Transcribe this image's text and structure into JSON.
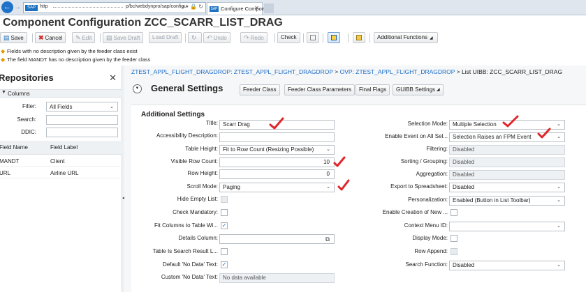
{
  "browser": {
    "protocol": "http",
    "url_visible": "p/bc/webdynpro/sap/configu",
    "address_tools": "⌕ ▾ 🔒 ↻",
    "tab_title": "Configure Component",
    "favicon_text": "SAP"
  },
  "page": {
    "title": "Component Configuration ZCC_SCARR_LIST_DRAG"
  },
  "toolbar": {
    "save": "Save",
    "cancel": "Cancel",
    "edit": "Edit",
    "save_draft": "Save Draft",
    "load_draft": "Load Draft",
    "undo": "Undo",
    "redo": "Redo",
    "check": "Check",
    "additional_functions": "Additional Functions"
  },
  "messages": [
    "Fields with no description given by the feeder class exist",
    "The field MANDT has no description given by the feeder class"
  ],
  "repositories": {
    "title": "Repositories",
    "columns_label": "Columns",
    "filter_label": "Filter:",
    "filter_value": "All Fields",
    "search_label": "Search:",
    "ddic_label": "DDIC:",
    "table_headers": [
      "Field Name",
      "Field Label"
    ],
    "rows": [
      {
        "field_name": "MANDT",
        "field_label": "Client"
      },
      {
        "field_name": "URL",
        "field_label": "Airline URL"
      }
    ]
  },
  "breadcrumb": {
    "link1": "ZTEST_APPL_FLIGHT_DRAGDROP: ZTEST_APPL_FLIGHT_DRAGDROP",
    "sep": " > ",
    "link2": "OVP: ZTEST_APPL_FLIGHT_DRAGDROP",
    "current": "List UIBB: ZCC_SCARR_LIST_DRAG"
  },
  "general_settings": {
    "title": "General Settings",
    "buttons": [
      "Feeder Class",
      "Feeder Class Parameters",
      "Final Flags",
      "GUIBB Settings"
    ]
  },
  "additional_settings": {
    "title": "Additional Settings",
    "left": {
      "title_label": "Title:",
      "title_value": "Scarr Drag",
      "accessibility_label": "Accessibility Description:",
      "table_height_label": "Table Height:",
      "table_height_value": "Fit to Row Count (Resizing Possible)",
      "visible_rows_label": "Visible Row Count:",
      "visible_rows_value": "10",
      "row_height_label": "Row Height:",
      "row_height_value": "0",
      "scroll_mode_label": "Scroll Mode:",
      "scroll_mode_value": "Paging",
      "hide_empty_label": "Hide Empty List:",
      "check_mandatory_label": "Check Mandatory:",
      "fit_columns_label": "Fit Columns to Table Wi...",
      "details_column_label": "Details Column:",
      "search_result_label": "Table Is Search Result L...",
      "default_no_data_label": "Default 'No Data' Text:",
      "custom_no_data_label": "Custom 'No Data' Text:",
      "custom_no_data_value": "No data available"
    },
    "right": {
      "selection_mode_label": "Selection Mode:",
      "selection_mode_value": "Multiple Selection",
      "enable_event_label": "Enable Event on All Sel...",
      "enable_event_value": "Selection Raises an FPM Event",
      "filtering_label": "Filtering:",
      "filtering_value": "Disabled",
      "sorting_label": "Sorting / Grouping:",
      "sorting_value": "Disabled",
      "aggregation_label": "Aggregation:",
      "aggregation_value": "Disabled",
      "export_label": "Export to Spreadsheet:",
      "export_value": "Disabled",
      "personalization_label": "Personalization:",
      "personalization_value": "Enabled (Button in List Toolbar)",
      "enable_creation_label": "Enable Creation of New ...",
      "context_menu_label": "Context Menu ID:",
      "display_mode_label": "Display Mode:",
      "row_append_label": "Row Append:",
      "search_function_label": "Search Function:",
      "search_function_value": "Disabled"
    }
  },
  "colors": {
    "link": "#1a6cc7",
    "annotation_check": "#e0262a",
    "warning": "#e39a00",
    "browser_blue": "#1e73c8"
  }
}
